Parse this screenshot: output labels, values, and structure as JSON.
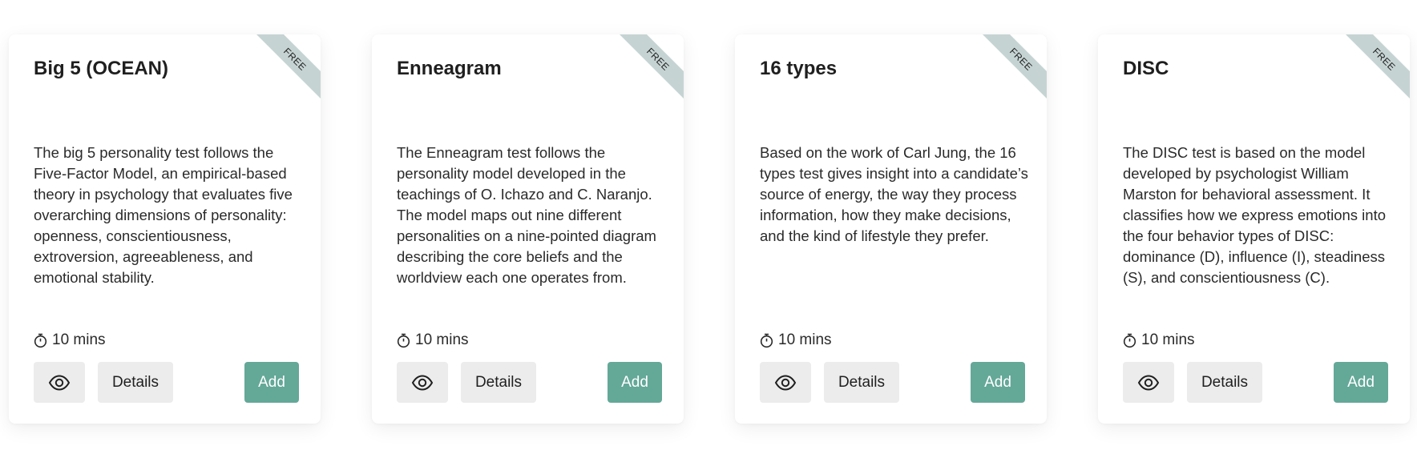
{
  "cards": [
    {
      "title": "Big 5 (OCEAN)",
      "badge": "FREE",
      "description": "The big 5 personality test follows the Five-Factor Model, an empirical-based theory in psychology that evaluates five overarching dimensions of personality: openness, conscientiousness, extroversion, agreeableness, and emotional stability.",
      "duration": "10 mins",
      "details_label": "Details",
      "add_label": "Add"
    },
    {
      "title": "Enneagram",
      "badge": "FREE",
      "description": "The Enneagram test follows the personality model developed in the teachings of O. Ichazo and C. Naranjo. The model maps out nine different personalities on a nine-pointed diagram describing the core beliefs and the worldview each one operates from.",
      "duration": "10 mins",
      "details_label": "Details",
      "add_label": "Add"
    },
    {
      "title": "16 types",
      "badge": "FREE",
      "description": "Based on the work of Carl Jung, the 16 types test gives insight into a candidate’s source of energy, the way they process information, how they make decisions, and the kind of lifestyle they prefer.",
      "duration": "10 mins",
      "details_label": "Details",
      "add_label": "Add"
    },
    {
      "title": "DISC",
      "badge": "FREE",
      "description": "The DISC test is based on the model developed by psychologist William Marston for behavioral assessment. It classifies how we express emotions into the four behavior types of DISC: dominance (D), influence (I), steadiness (S), and conscientiousness (C).",
      "duration": "10 mins",
      "details_label": "Details",
      "add_label": "Add"
    }
  ],
  "icons": {
    "preview": "eye-icon",
    "duration": "stopwatch-icon"
  },
  "colors": {
    "add_button": "#64a898",
    "secondary_button": "#ececec",
    "ribbon": "#c6d3d3"
  }
}
